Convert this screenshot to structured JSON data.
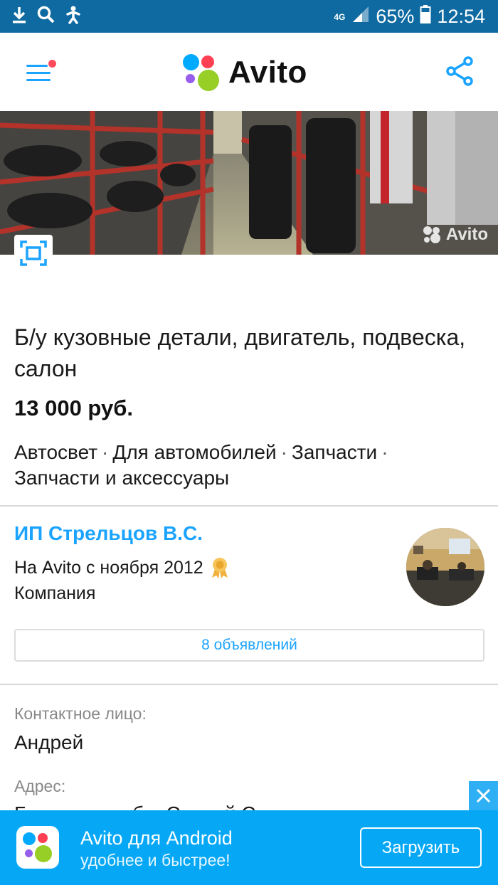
{
  "status_bar": {
    "network": "4G",
    "battery": "65%",
    "time": "12:54",
    "icons": [
      "download-icon",
      "search-icon",
      "accessibility-icon",
      "signal-icon",
      "battery-icon"
    ]
  },
  "header": {
    "logo_text": "Avito",
    "menu_icon": "menu-icon",
    "share_icon": "share-icon",
    "logo_colors": [
      "#0af",
      "#ff4053",
      "#965eeb",
      "#97cf26"
    ]
  },
  "listing": {
    "photo_watermark": "Avito",
    "title": "Б/у кузовные детали, двигатель, подвеска, салон",
    "price": "13 000 руб.",
    "categories": [
      "Автосвет",
      "Для автомобилей",
      "Запчасти",
      "Запчасти и аксессуары"
    ]
  },
  "seller": {
    "name": "ИП Стрельцов В.С.",
    "since": "На Avito с ноября 2012",
    "type": "Компания",
    "ads_button": "8 объявлений"
  },
  "contact": {
    "person_label": "Контактное лицо:",
    "person_name": "Андрей",
    "address_label": "Адрес:",
    "address_partial": "Б... ... ... ... ...б... С... ... й С..."
  },
  "banner": {
    "title": "Avito для Android",
    "subtitle": "удобнее и быстрее!",
    "button": "Загрузить",
    "close_icon": "close-icon"
  },
  "colors": {
    "accent": "#1aa3ff",
    "status_bar": "#0e6aa0",
    "banner": "#06a8f5"
  }
}
